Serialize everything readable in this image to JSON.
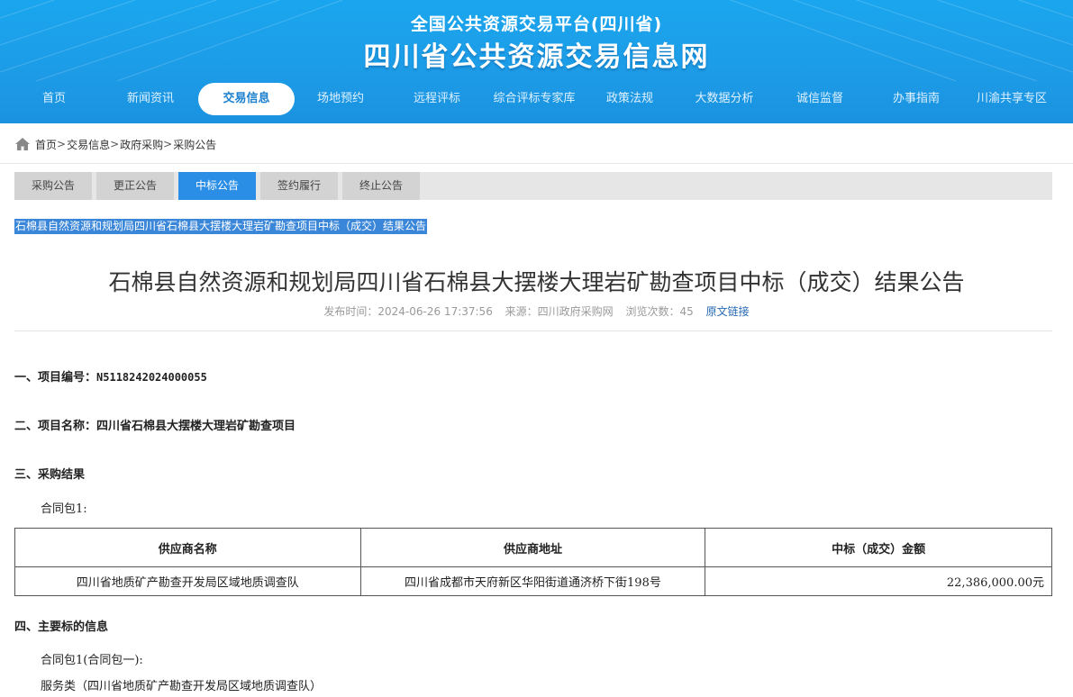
{
  "header": {
    "subtitle": "全国公共资源交易平台(四川省)",
    "title": "四川省公共资源交易信息网"
  },
  "nav": {
    "items": [
      {
        "label": "首页",
        "active": false
      },
      {
        "label": "新闻资讯",
        "active": false
      },
      {
        "label": "交易信息",
        "active": true
      },
      {
        "label": "场地预约",
        "active": false
      },
      {
        "label": "远程评标",
        "active": false
      },
      {
        "label": "综合评标专家库",
        "active": false
      },
      {
        "label": "政策法规",
        "active": false
      },
      {
        "label": "大数据分析",
        "active": false
      },
      {
        "label": "诚信监督",
        "active": false
      },
      {
        "label": "办事指南",
        "active": false
      },
      {
        "label": "川渝共享专区",
        "active": false
      }
    ]
  },
  "breadcrumb": {
    "items": [
      "首页",
      "交易信息",
      "政府采购",
      "采购公告"
    ],
    "separator": ">"
  },
  "tabs": {
    "items": [
      {
        "label": "采购公告",
        "active": false
      },
      {
        "label": "更正公告",
        "active": false
      },
      {
        "label": "中标公告",
        "active": true
      },
      {
        "label": "签约履行",
        "active": false
      },
      {
        "label": "终止公告",
        "active": false
      }
    ]
  },
  "selected_title": "石棉县自然资源和规划局四川省石棉县大摆楼大理岩矿勘查项目中标（成交）结果公告",
  "article": {
    "title": "石棉县自然资源和规划局四川省石棉县大摆楼大理岩矿勘查项目中标（成交）结果公告",
    "publish_time": "发布时间：2024-06-26 17:37:56",
    "source": "来源：四川政府采购网",
    "views": "浏览次数：45",
    "source_link": "原文链接"
  },
  "content": {
    "sec1_label": "一、项目编号：",
    "sec1_value": "N5118242024000055",
    "sec2": "二、项目名称：四川省石棉县大摆楼大理岩矿勘查项目",
    "sec3": "三、采购结果",
    "package1": "合同包1:",
    "table": {
      "headers": [
        "供应商名称",
        "供应商地址",
        "中标（成交）金额"
      ],
      "rows": [
        [
          "四川省地质矿产勘查开发局区域地质调查队",
          "四川省成都市天府新区华阳街道通济桥下街198号",
          "22,386,000.00元"
        ]
      ]
    },
    "sec4": "四、主要标的信息",
    "package1_name": "合同包1(合同包一):",
    "service_type": "服务类（四川省地质矿产勘查开发局区域地质调查队）"
  },
  "colors": {
    "header_blue": "#1d9be6",
    "tab_active": "#2a8ee6",
    "link": "#2569b5"
  }
}
